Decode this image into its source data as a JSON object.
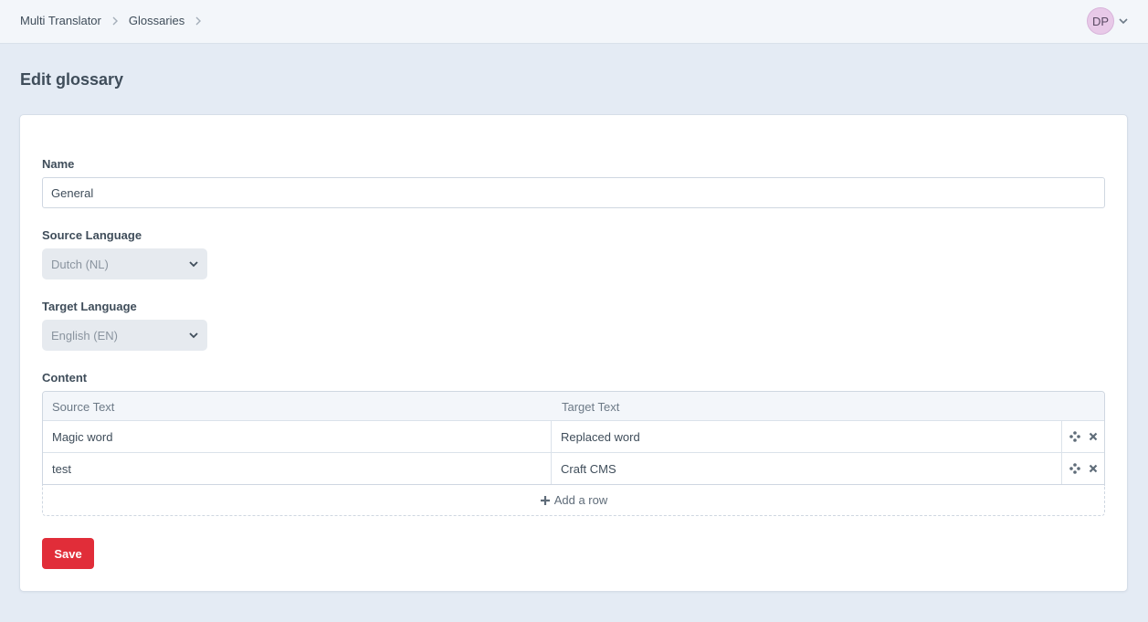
{
  "breadcrumb": {
    "items": [
      "Multi Translator",
      "Glossaries"
    ]
  },
  "account": {
    "initials": "DP",
    "avatar_color": "#e8c9e8"
  },
  "page": {
    "title": "Edit glossary"
  },
  "form": {
    "name_label": "Name",
    "name_value": "General",
    "source_language_label": "Source Language",
    "source_language_value": "Dutch (NL)",
    "target_language_label": "Target Language",
    "target_language_value": "English (EN)",
    "content_label": "Content",
    "table": {
      "columns": [
        "Source Text",
        "Target Text"
      ],
      "rows": [
        {
          "source": "Magic word",
          "target": "Replaced word"
        },
        {
          "source": "test",
          "target": "Craft CMS"
        }
      ],
      "add_row_label": "Add a row"
    },
    "save_label": "Save"
  },
  "colors": {
    "accent": "#e12d39",
    "background": "#e4ebf4"
  }
}
